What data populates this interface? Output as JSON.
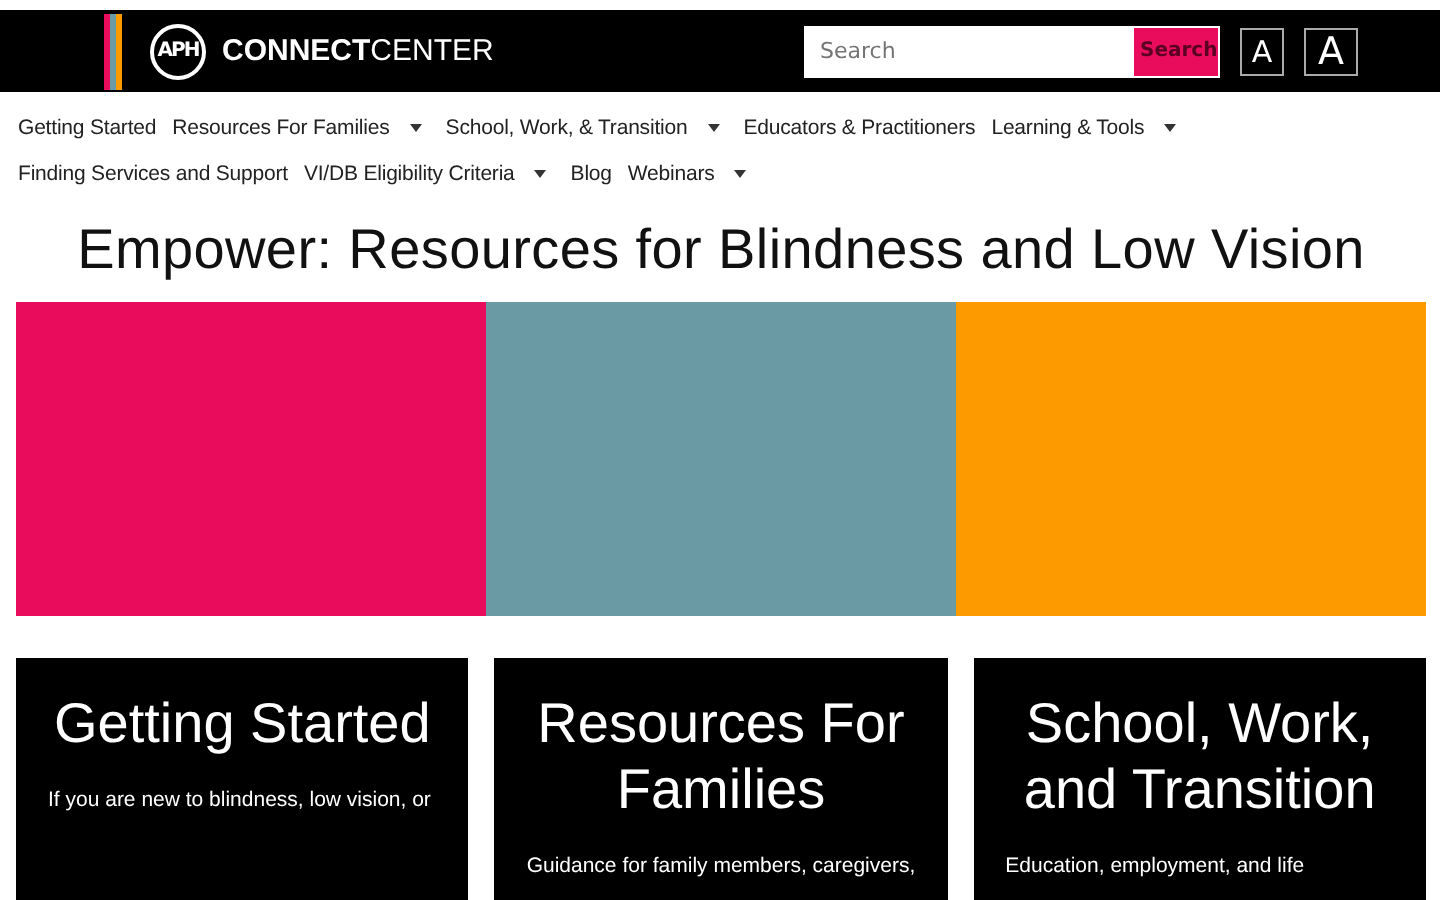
{
  "header": {
    "logo_mark": "APH",
    "logo_bold": "CONNECT",
    "logo_light": "CENTER",
    "search": {
      "placeholder": "Search",
      "button": "Search"
    },
    "text_size_buttons": [
      {
        "label": "A"
      },
      {
        "label": "A"
      }
    ]
  },
  "nav": [
    {
      "label": "Getting Started",
      "dropdown": false
    },
    {
      "label": "Resources For Families",
      "dropdown": true
    },
    {
      "label": "School, Work, & Transition",
      "dropdown": true
    },
    {
      "label": "Educators & Practitioners",
      "dropdown": false
    },
    {
      "label": "Learning & Tools",
      "dropdown": true
    },
    {
      "label": "Finding Services and Support",
      "dropdown": false
    },
    {
      "label": "VI/DB Eligibility Criteria",
      "dropdown": true
    },
    {
      "label": "Blog",
      "dropdown": false
    },
    {
      "label": "Webinars",
      "dropdown": true
    }
  ],
  "title": "Empower: Resources for Blindness and Low Vision",
  "color_panels": [
    {
      "color": "#e90c5c"
    },
    {
      "color": "#6a9ba5"
    },
    {
      "color": "#fd9a00"
    }
  ],
  "cards": [
    {
      "title": "Getting Started",
      "text": "If you are new to blindness, low vision, or"
    },
    {
      "title": "Resources For Families",
      "text": "Guidance for family members, caregivers,"
    },
    {
      "title": "School, Work, and Transition",
      "text": "Education, employment, and life"
    }
  ]
}
